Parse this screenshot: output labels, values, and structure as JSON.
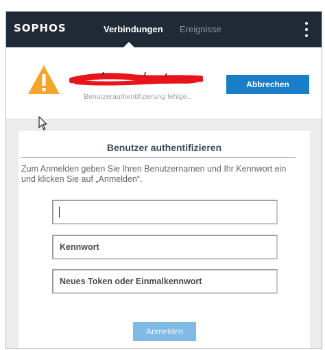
{
  "header": {
    "logo": "SOPHOS",
    "tabs": [
      {
        "label": "Verbindungen",
        "active": true
      },
      {
        "label": "Ereignisse",
        "active": false
      }
    ]
  },
  "status": {
    "connection_name_redacted": true,
    "message": "Benutzerauthentifizierung fehlge..",
    "cancel_button": "Abbrechen"
  },
  "auth": {
    "title": "Benutzer authentifizieren",
    "instructions": "Zum Anmelden geben Sie Ihren Benutzernamen und Ihr Kennwort ein und klicken Sie auf „Anmelden“.",
    "username": {
      "value": "",
      "placeholder": ""
    },
    "password": {
      "value": "",
      "placeholder": "Kennwort"
    },
    "token": {
      "value": "",
      "placeholder": "Neues Token oder Einmalkennwort"
    },
    "login_button": "Anmelden"
  },
  "colors": {
    "header_bg": "#1f2a36",
    "accent": "#1a7dc8",
    "accent_disabled": "#7fb9e6",
    "warning": "#f4a62a",
    "redaction": "#e8131b"
  }
}
